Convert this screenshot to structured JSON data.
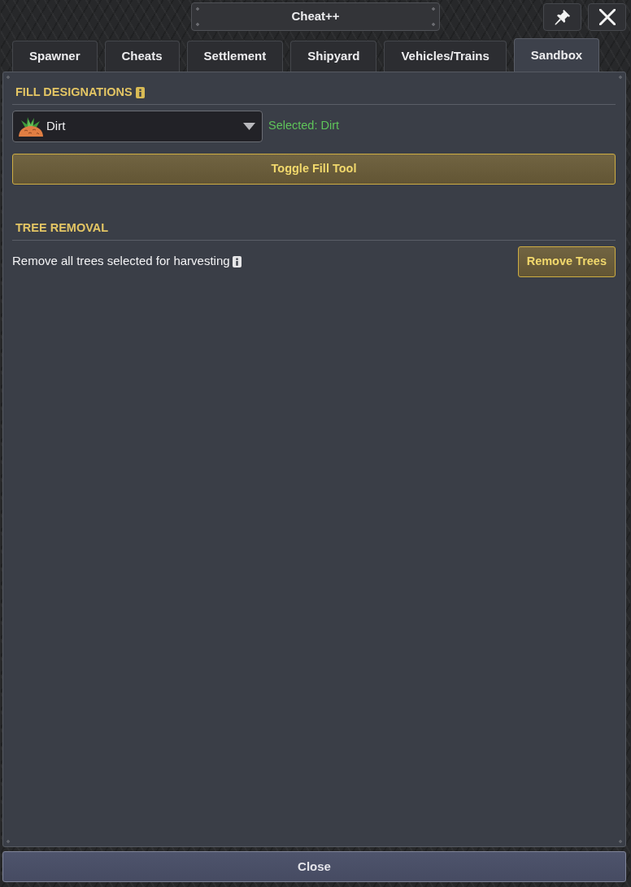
{
  "window": {
    "title": "Cheat++"
  },
  "tabs": [
    {
      "label": "Spawner",
      "selected": false
    },
    {
      "label": "Cheats",
      "selected": false
    },
    {
      "label": "Settlement",
      "selected": false
    },
    {
      "label": "Shipyard",
      "selected": false
    },
    {
      "label": "Vehicles/Trains",
      "selected": false
    },
    {
      "label": "Sandbox",
      "selected": true
    }
  ],
  "sections": [
    {
      "kind": "fill",
      "title": "FILL DESIGNATIONS",
      "info": true,
      "dropdown": {
        "value": "Dirt"
      },
      "selected_text": "Selected: Dirt",
      "button": "Toggle Fill Tool"
    },
    {
      "kind": "action",
      "title": "TREE REMOVAL",
      "info": false,
      "description": "Remove all trees selected for harvesting",
      "description_info": true,
      "button": "Remove Trees"
    }
  ],
  "footer": {
    "button": "Close"
  }
}
